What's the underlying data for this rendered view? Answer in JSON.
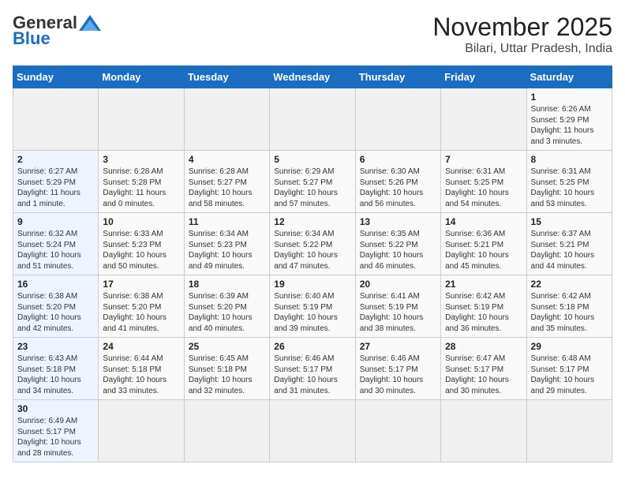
{
  "header": {
    "logo_general": "General",
    "logo_blue": "Blue",
    "month_title": "November 2025",
    "subtitle": "Bilari, Uttar Pradesh, India"
  },
  "days_of_week": [
    "Sunday",
    "Monday",
    "Tuesday",
    "Wednesday",
    "Thursday",
    "Friday",
    "Saturday"
  ],
  "weeks": [
    [
      {
        "day": "",
        "info": ""
      },
      {
        "day": "",
        "info": ""
      },
      {
        "day": "",
        "info": ""
      },
      {
        "day": "",
        "info": ""
      },
      {
        "day": "",
        "info": ""
      },
      {
        "day": "",
        "info": ""
      },
      {
        "day": "1",
        "info": "Sunrise: 6:26 AM\nSunset: 5:29 PM\nDaylight: 11 hours\nand 3 minutes."
      }
    ],
    [
      {
        "day": "2",
        "info": "Sunrise: 6:27 AM\nSunset: 5:29 PM\nDaylight: 11 hours\nand 1 minute."
      },
      {
        "day": "3",
        "info": "Sunrise: 6:28 AM\nSunset: 5:28 PM\nDaylight: 11 hours\nand 0 minutes."
      },
      {
        "day": "4",
        "info": "Sunrise: 6:28 AM\nSunset: 5:27 PM\nDaylight: 10 hours\nand 58 minutes."
      },
      {
        "day": "5",
        "info": "Sunrise: 6:29 AM\nSunset: 5:27 PM\nDaylight: 10 hours\nand 57 minutes."
      },
      {
        "day": "6",
        "info": "Sunrise: 6:30 AM\nSunset: 5:26 PM\nDaylight: 10 hours\nand 56 minutes."
      },
      {
        "day": "7",
        "info": "Sunrise: 6:31 AM\nSunset: 5:25 PM\nDaylight: 10 hours\nand 54 minutes."
      },
      {
        "day": "8",
        "info": "Sunrise: 6:31 AM\nSunset: 5:25 PM\nDaylight: 10 hours\nand 53 minutes."
      }
    ],
    [
      {
        "day": "9",
        "info": "Sunrise: 6:32 AM\nSunset: 5:24 PM\nDaylight: 10 hours\nand 51 minutes."
      },
      {
        "day": "10",
        "info": "Sunrise: 6:33 AM\nSunset: 5:23 PM\nDaylight: 10 hours\nand 50 minutes."
      },
      {
        "day": "11",
        "info": "Sunrise: 6:34 AM\nSunset: 5:23 PM\nDaylight: 10 hours\nand 49 minutes."
      },
      {
        "day": "12",
        "info": "Sunrise: 6:34 AM\nSunset: 5:22 PM\nDaylight: 10 hours\nand 47 minutes."
      },
      {
        "day": "13",
        "info": "Sunrise: 6:35 AM\nSunset: 5:22 PM\nDaylight: 10 hours\nand 46 minutes."
      },
      {
        "day": "14",
        "info": "Sunrise: 6:36 AM\nSunset: 5:21 PM\nDaylight: 10 hours\nand 45 minutes."
      },
      {
        "day": "15",
        "info": "Sunrise: 6:37 AM\nSunset: 5:21 PM\nDaylight: 10 hours\nand 44 minutes."
      }
    ],
    [
      {
        "day": "16",
        "info": "Sunrise: 6:38 AM\nSunset: 5:20 PM\nDaylight: 10 hours\nand 42 minutes."
      },
      {
        "day": "17",
        "info": "Sunrise: 6:38 AM\nSunset: 5:20 PM\nDaylight: 10 hours\nand 41 minutes."
      },
      {
        "day": "18",
        "info": "Sunrise: 6:39 AM\nSunset: 5:20 PM\nDaylight: 10 hours\nand 40 minutes."
      },
      {
        "day": "19",
        "info": "Sunrise: 6:40 AM\nSunset: 5:19 PM\nDaylight: 10 hours\nand 39 minutes."
      },
      {
        "day": "20",
        "info": "Sunrise: 6:41 AM\nSunset: 5:19 PM\nDaylight: 10 hours\nand 38 minutes."
      },
      {
        "day": "21",
        "info": "Sunrise: 6:42 AM\nSunset: 5:19 PM\nDaylight: 10 hours\nand 36 minutes."
      },
      {
        "day": "22",
        "info": "Sunrise: 6:42 AM\nSunset: 5:18 PM\nDaylight: 10 hours\nand 35 minutes."
      }
    ],
    [
      {
        "day": "23",
        "info": "Sunrise: 6:43 AM\nSunset: 5:18 PM\nDaylight: 10 hours\nand 34 minutes."
      },
      {
        "day": "24",
        "info": "Sunrise: 6:44 AM\nSunset: 5:18 PM\nDaylight: 10 hours\nand 33 minutes."
      },
      {
        "day": "25",
        "info": "Sunrise: 6:45 AM\nSunset: 5:18 PM\nDaylight: 10 hours\nand 32 minutes."
      },
      {
        "day": "26",
        "info": "Sunrise: 6:46 AM\nSunset: 5:17 PM\nDaylight: 10 hours\nand 31 minutes."
      },
      {
        "day": "27",
        "info": "Sunrise: 6:46 AM\nSunset: 5:17 PM\nDaylight: 10 hours\nand 30 minutes."
      },
      {
        "day": "28",
        "info": "Sunrise: 6:47 AM\nSunset: 5:17 PM\nDaylight: 10 hours\nand 30 minutes."
      },
      {
        "day": "29",
        "info": "Sunrise: 6:48 AM\nSunset: 5:17 PM\nDaylight: 10 hours\nand 29 minutes."
      }
    ],
    [
      {
        "day": "30",
        "info": "Sunrise: 6:49 AM\nSunset: 5:17 PM\nDaylight: 10 hours\nand 28 minutes."
      },
      {
        "day": "",
        "info": ""
      },
      {
        "day": "",
        "info": ""
      },
      {
        "day": "",
        "info": ""
      },
      {
        "day": "",
        "info": ""
      },
      {
        "day": "",
        "info": ""
      },
      {
        "day": "",
        "info": ""
      }
    ]
  ]
}
